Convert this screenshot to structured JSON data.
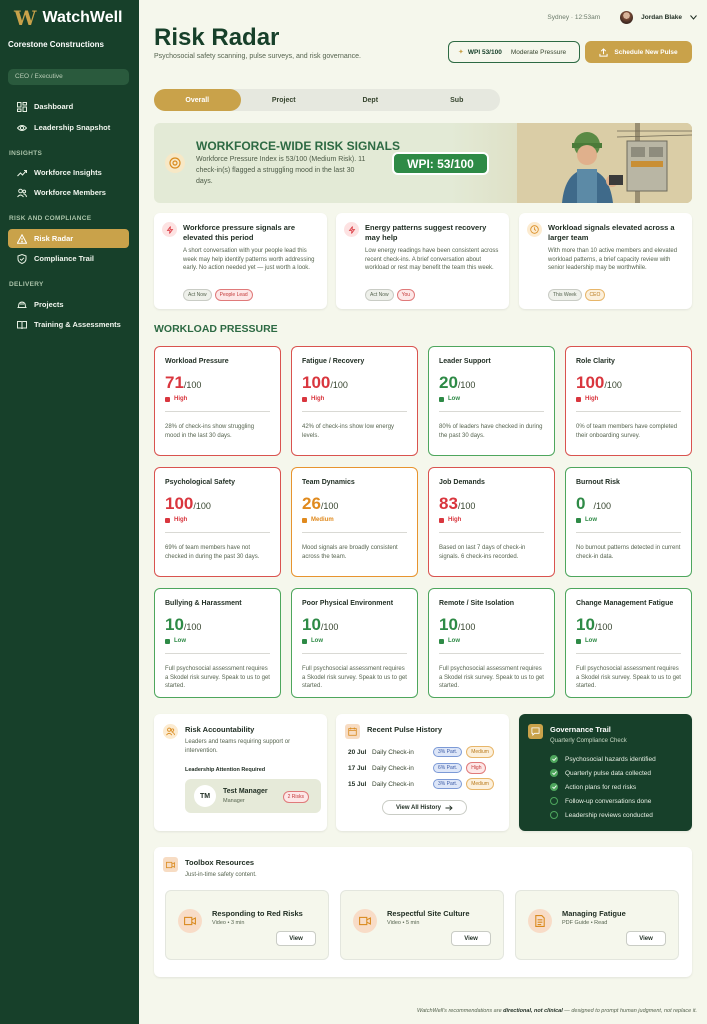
{
  "app": {
    "brand": "WatchWell",
    "company": "Corestone Constructions",
    "role": "CEO / Executive"
  },
  "sidebar": {
    "items_top": [
      {
        "label": "Dashboard",
        "icon": "dashboard-icon"
      },
      {
        "label": "Leadership Snapshot",
        "icon": "eye-icon"
      }
    ],
    "section_insights": "INSIGHTS",
    "items_insights": [
      {
        "label": "Workforce Insights",
        "icon": "trend-icon"
      },
      {
        "label": "Workforce Members",
        "icon": "users-icon"
      }
    ],
    "section_risk": "RISK AND COMPLIANCE",
    "items_risk": [
      {
        "label": "Risk Radar",
        "icon": "warning-icon",
        "active": true
      },
      {
        "label": "Compliance Trail",
        "icon": "shield-icon"
      }
    ],
    "section_delivery": "DELIVERY",
    "items_delivery": [
      {
        "label": "Projects",
        "icon": "hardhat-icon"
      },
      {
        "label": "Training & Assessments",
        "icon": "book-icon"
      }
    ]
  },
  "header": {
    "location_time": "Sydney · 12:53am",
    "user_name": "Jordan Blake",
    "title": "Risk Radar",
    "subtitle": "Psychosocial safety scanning, pulse surveys, and risk governance.",
    "wpi_label": "WPI 53/100",
    "wpi_status": "Moderate Pressure",
    "new_pulse_button": "Schedule New Pulse"
  },
  "tabs": [
    "Overall",
    "Project",
    "Dept",
    "Sub"
  ],
  "banner": {
    "title": "WORKFORCE-WIDE RISK SIGNALS",
    "text": "Workforce Pressure Index is 53/100 (Medium Risk). 11 check-in(s) flagged a struggling mood in the last 30 days.",
    "wpi_box": "WPI: 53/100"
  },
  "signals": [
    {
      "title": "Workforce pressure signals are elevated this period",
      "text": "A short conversation with your people lead this week may help identify patterns worth addressing early. No action needed yet — just worth a look.",
      "tags": [
        "Act Now",
        "People Lead"
      ]
    },
    {
      "title": "Energy patterns suggest recovery may help",
      "text": "Low energy readings have been consistent across recent check-ins. A brief conversation about workload or rest may benefit the team this week.",
      "tags": [
        "Act Now",
        "You"
      ]
    },
    {
      "title": "Workload signals elevated across a larger team",
      "text": "With more than 10 active members and elevated workload patterns, a brief capacity review with senior leadership may be worthwhile.",
      "tags": [
        "This Week",
        "CEO"
      ]
    }
  ],
  "workload_title": "WORKLOAD PRESSURE",
  "cards": [
    {
      "title": "Workload Pressure",
      "score": "71",
      "max": "/100",
      "level": "High",
      "desc": "28% of check-ins show struggling mood in the last 30 days."
    },
    {
      "title": "Fatigue / Recovery",
      "score": "100",
      "max": "/100",
      "level": "High",
      "desc": "42% of check-ins show low energy levels."
    },
    {
      "title": "Leader Support",
      "score": "20",
      "max": "/100",
      "level": "Low",
      "desc": "80% of leaders have checked in during the past 30 days."
    },
    {
      "title": "Role Clarity",
      "score": "100",
      "max": "/100",
      "level": "High",
      "desc": "0% of team members have completed their onboarding survey."
    },
    {
      "title": "Psychological Safety",
      "score": "100",
      "max": "/100",
      "level": "High",
      "desc": "69% of team members have not checked in during the past 30 days."
    },
    {
      "title": "Team Dynamics",
      "score": "26",
      "max": "/100",
      "level": "Medium",
      "desc": "Mood signals are broadly consistent across the team."
    },
    {
      "title": "Job Demands",
      "score": "83",
      "max": "/100",
      "level": "High",
      "desc": "Based on last 7 days of check-in signals. 6 check-ins recorded."
    },
    {
      "title": "Burnout Risk",
      "score": "0",
      "max": "/100",
      "level": "Low",
      "desc": "No burnout patterns detected in current check-in data."
    },
    {
      "title": "Bullying & Harassment",
      "score": "10",
      "max": "/100",
      "level": "Low",
      "desc": "Full psychosocial assessment requires a Skodel risk survey. Speak to us to get started."
    },
    {
      "title": "Poor Physical Environment",
      "score": "10",
      "max": "/100",
      "level": "Low",
      "desc": "Full psychosocial assessment requires a Skodel risk survey. Speak to us to get started."
    },
    {
      "title": "Remote / Site Isolation",
      "score": "10",
      "max": "/100",
      "level": "Low",
      "desc": "Full psychosocial assessment requires a Skodel risk survey. Speak to us to get started."
    },
    {
      "title": "Change Management Fatigue",
      "score": "10",
      "max": "/100",
      "level": "Low",
      "desc": "Full psychosocial assessment requires a Skodel risk survey. Speak to us to get started."
    }
  ],
  "accountability": {
    "title": "Risk Accountability",
    "desc": "Leaders and teams requiring support or intervention.",
    "required": "Leadership Attention Required",
    "initials": "TM",
    "manager_name": "Test Manager",
    "manager_role": "Manager",
    "badge": "2 Risks"
  },
  "history": {
    "title": "Recent Pulse History",
    "rows": [
      {
        "date": "20 Jul",
        "name": "Daily Check-in",
        "part": "3% Part.",
        "level": "Medium"
      },
      {
        "date": "17 Jul",
        "name": "Daily Check-in",
        "part": "6% Part.",
        "level": "High"
      },
      {
        "date": "15 Jul",
        "name": "Daily Check-in",
        "part": "3% Part.",
        "level": "Medium"
      }
    ],
    "view_all": "View All History"
  },
  "governance": {
    "title": "Governance Trail",
    "subtitle": "Quarterly Compliance Check",
    "items": [
      {
        "label": "Psychosocial hazards identified",
        "done": true
      },
      {
        "label": "Quarterly pulse data collected",
        "done": true
      },
      {
        "label": "Action plans for red risks",
        "done": true
      },
      {
        "label": "Follow-up conversations done",
        "done": false
      },
      {
        "label": "Leadership reviews conducted",
        "done": false
      }
    ]
  },
  "toolbox": {
    "title": "Toolbox Resources",
    "subtitle": "Just-in-time safety content.",
    "resources": [
      {
        "title": "Responding to Red Risks",
        "sub": "Video • 3 min",
        "button": "View",
        "icon": "video-icon"
      },
      {
        "title": "Respectful Site Culture",
        "sub": "Video • 5 min",
        "button": "View",
        "icon": "video-icon"
      },
      {
        "title": "Managing Fatigue",
        "sub": "PDF Guide • Read",
        "button": "View",
        "icon": "document-icon"
      }
    ]
  },
  "footer": {
    "prefix": "WatchWell's recommendations are ",
    "bold": "directional, not clinical",
    "suffix": " — designed to prompt human judgment, not replace it."
  },
  "colors": {
    "sidebar": "#17402a",
    "accent": "#c9a24a",
    "high": "#d9363e",
    "medium": "#e08a1e",
    "low": "#2e8a46"
  }
}
